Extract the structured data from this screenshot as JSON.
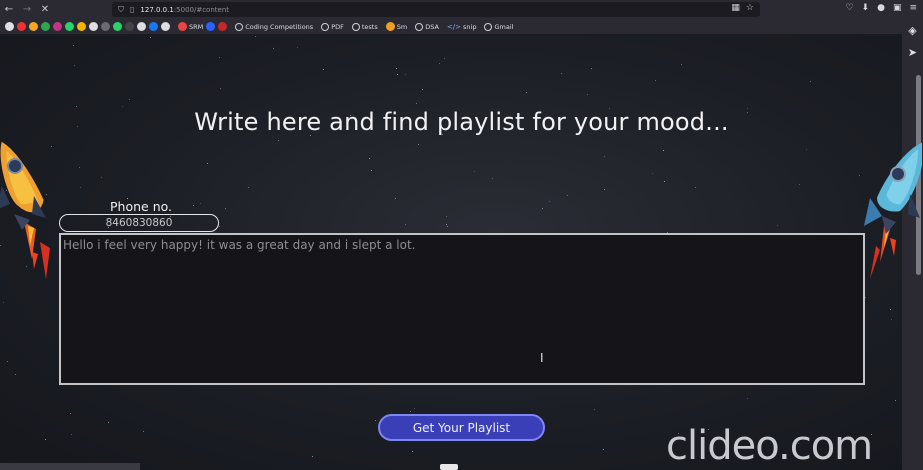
{
  "browser": {
    "url_host": "127.0.0.1",
    "url_rest": ":5000/#content",
    "bookmarks": [
      {
        "label": "SRM"
      },
      {
        "label": "Coding Competitions"
      },
      {
        "label": "PDF"
      },
      {
        "label": "tests"
      },
      {
        "label": "Sm"
      },
      {
        "label": "DSA"
      },
      {
        "label": "snip"
      },
      {
        "label": "Gmail"
      }
    ]
  },
  "main": {
    "heading": "Write here and find playlist for your mood...",
    "phone_label": "Phone no.",
    "phone_value": "8460830860",
    "mood_text": "Hello i feel very happy! it was a great day and i slept a lot.",
    "submit_label": "Get Your Playlist"
  },
  "watermark": "clideo.com",
  "colors": {
    "background": "#1c1e25",
    "button": "#3a3fb8",
    "button_border": "#8086f0",
    "text": "#f2f2f4"
  }
}
